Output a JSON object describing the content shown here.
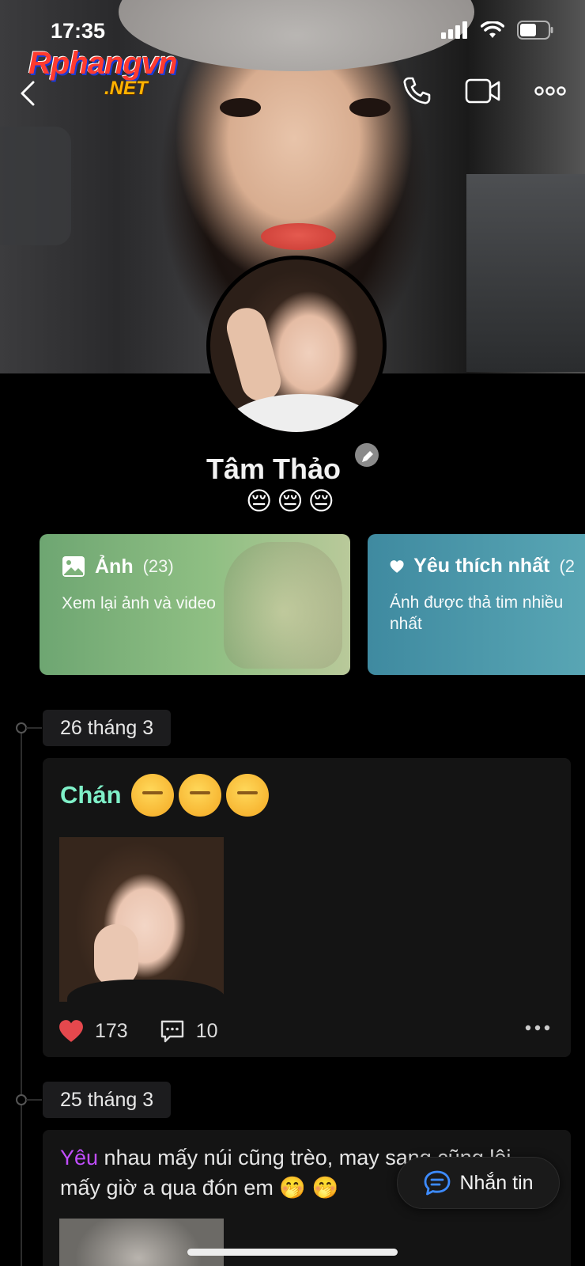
{
  "status_bar": {
    "time": "17:35"
  },
  "watermark": {
    "main": "Rphangvn",
    "sub": ".NET"
  },
  "profile": {
    "name": "Tâm Thảo",
    "bio_emoji": "😔😔😔"
  },
  "cards": [
    {
      "title": "Ảnh",
      "count": "(23)",
      "description": "Xem lại ảnh và video"
    },
    {
      "title": "Yêu thích nhất",
      "count": "(2",
      "description": "Ảnh được thả tim nhiều nhất"
    }
  ],
  "timeline": [
    {
      "date": "26 tháng 3",
      "title_word": "Chán",
      "likes": "173",
      "comments": "10"
    },
    {
      "date": "25 tháng 3",
      "text_accent": "Yêu",
      "text_rest": " nhau mấy núi cũng trèo, may sang cũng lội mấy giờ a qua đón em 🤭 🤭"
    }
  ],
  "fab": {
    "label": "Nhắn tin"
  },
  "colors": {
    "accent_title": "#7ff0c8",
    "accent_purple": "#c14dff",
    "heart": "#e5484d",
    "fab_icon": "#3d8bff"
  }
}
